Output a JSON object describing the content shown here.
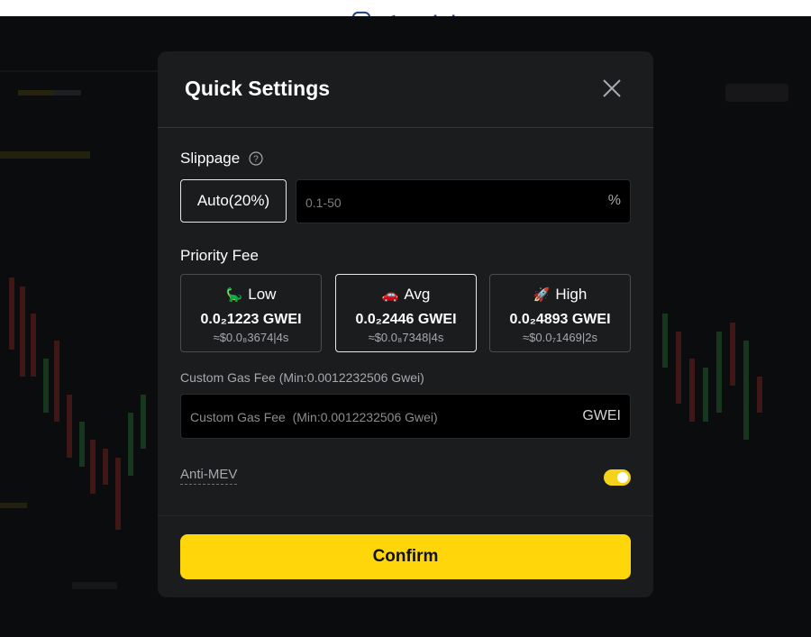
{
  "brand": {
    "name": "ایران بروکر",
    "color": "#1d3f8f"
  },
  "colors": {
    "accent": "#ffd60a",
    "modal_bg": "#1b1c1e",
    "input_bg": "#000000"
  },
  "modal": {
    "title": "Quick Settings",
    "close_icon": "close-icon"
  },
  "slippage": {
    "label": "Slippage",
    "help_icon": "question-circle-icon",
    "auto_label": "Auto(20%)",
    "input_placeholder": "0.1-50",
    "unit": "%"
  },
  "priority_fee": {
    "label": "Priority Fee",
    "options": [
      {
        "emoji": "🦕",
        "name": "Low",
        "gwei": "0.0₂1223 GWEI",
        "usd": "≈$0.0₈3674|4s",
        "selected": false
      },
      {
        "emoji": "🚗",
        "name": "Avg",
        "gwei": "0.0₂2446 GWEI",
        "usd": "≈$0.0₈7348|4s",
        "selected": true
      },
      {
        "emoji": "🚀",
        "name": "High",
        "gwei": "0.0₂4893 GWEI",
        "usd": "≈$0.0₇1469|2s",
        "selected": false
      }
    ]
  },
  "custom_gas": {
    "label": "Custom Gas Fee  (Min:0.0012232506 Gwei)",
    "placeholder": "Custom Gas Fee  (Min:0.0012232506 Gwei)",
    "unit": "GWEI"
  },
  "anti_mev": {
    "label": "Anti-MEV",
    "enabled": true
  },
  "confirm": {
    "label": "Confirm"
  }
}
